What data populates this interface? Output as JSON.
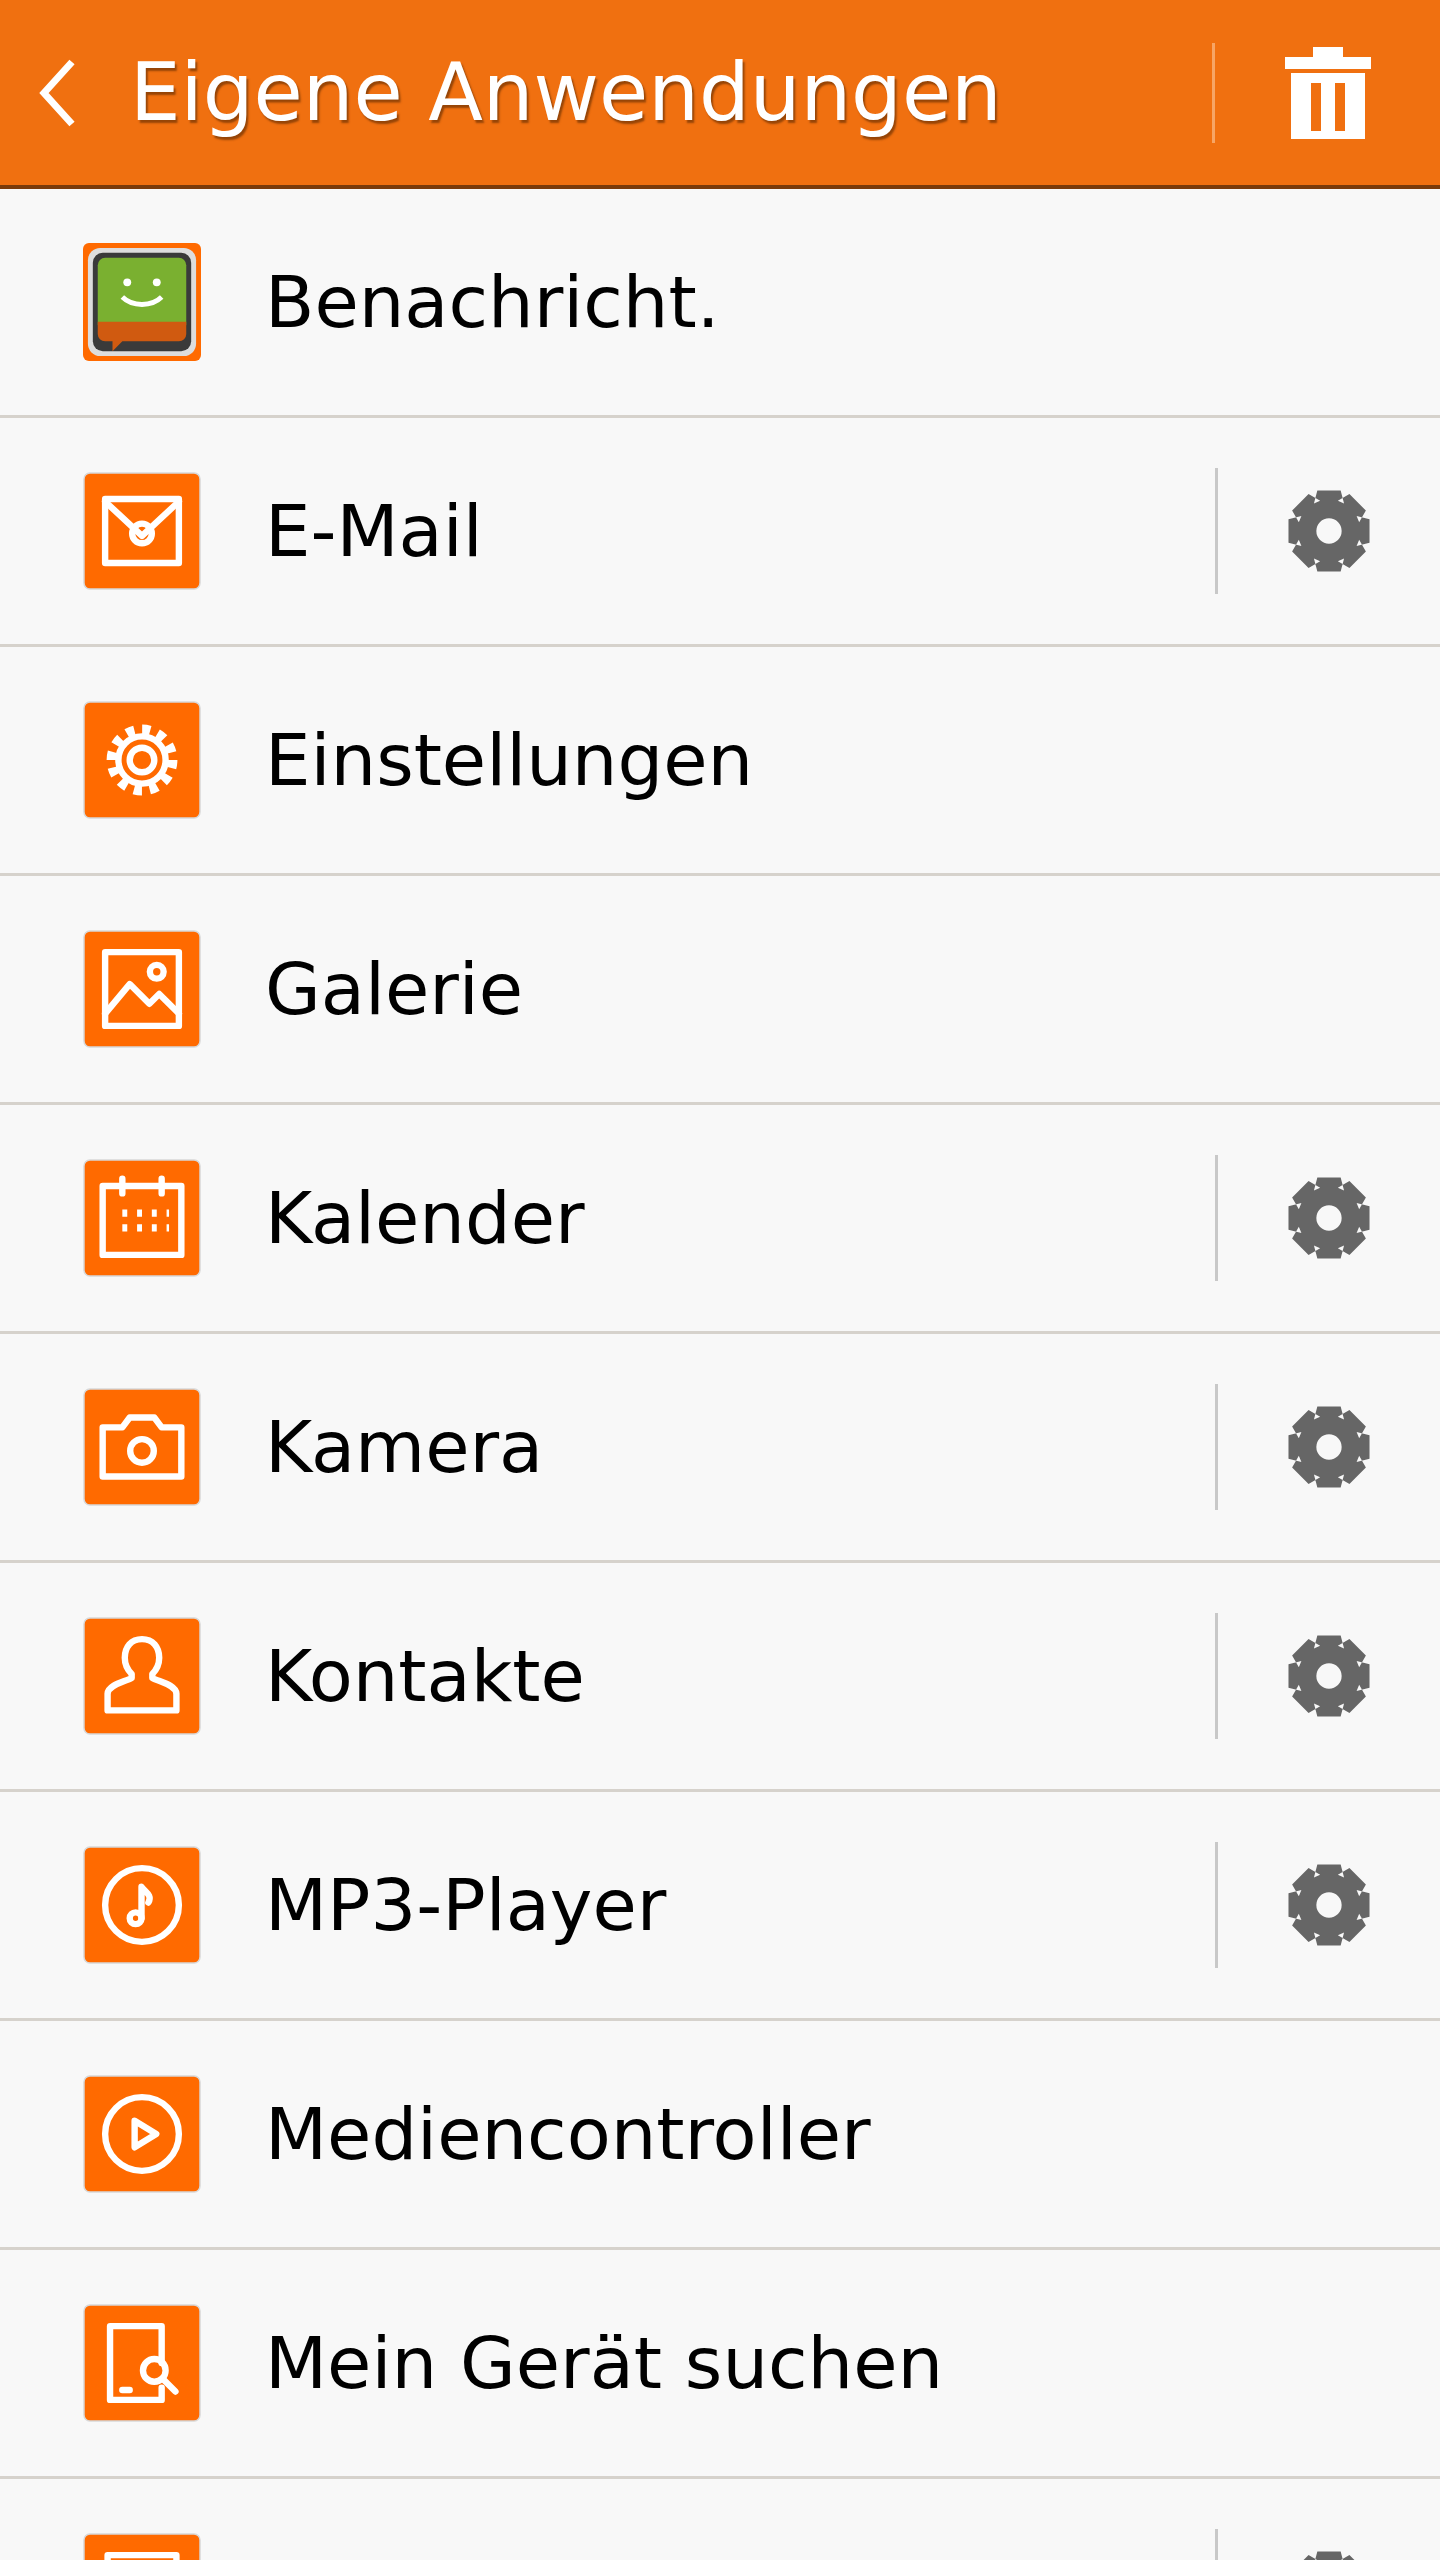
{
  "header": {
    "title": "Eigene Anwendungen"
  },
  "apps": [
    {
      "kind": "messages",
      "label": "Benachricht.",
      "settings": false
    },
    {
      "kind": "email",
      "label": "E-Mail",
      "settings": true
    },
    {
      "kind": "settings",
      "label": "Einstellungen",
      "settings": false
    },
    {
      "kind": "gallery",
      "label": "Galerie",
      "settings": false
    },
    {
      "kind": "calendar",
      "label": "Kalender",
      "settings": true
    },
    {
      "kind": "camera",
      "label": "Kamera",
      "settings": true
    },
    {
      "kind": "contacts",
      "label": "Kontakte",
      "settings": true
    },
    {
      "kind": "music",
      "label": "MP3-Player",
      "settings": true
    },
    {
      "kind": "media",
      "label": "Mediencontroller",
      "settings": false
    },
    {
      "kind": "finder",
      "label": "Mein Gerät suchen",
      "settings": false
    },
    {
      "kind": "memo",
      "settings": true
    }
  ]
}
